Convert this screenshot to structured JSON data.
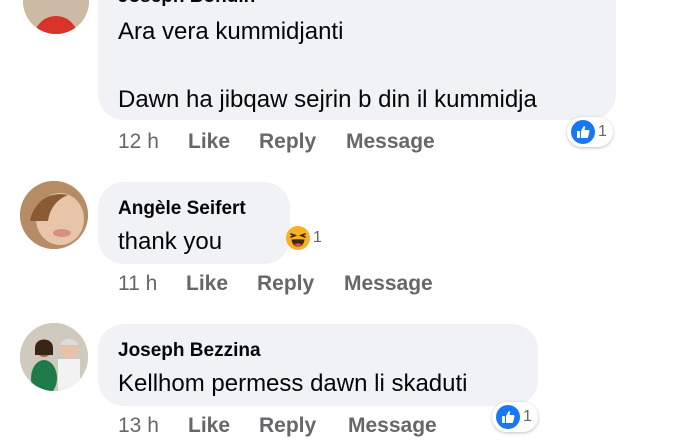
{
  "comments": [
    {
      "author": "Joseph Bondin",
      "lines": [
        "Ara vera kummidjanti",
        "Dawn ha jibqaw sejrin b din il kummidja"
      ],
      "time": "12 h",
      "reaction": {
        "icon": "like-icon",
        "count": "1",
        "color": "#1877f2"
      }
    },
    {
      "author": "Angèle Seifert",
      "lines": [
        "thank you"
      ],
      "time": "11 h",
      "reaction": {
        "icon": "haha-icon",
        "count": "1",
        "color": "#f7b125"
      }
    },
    {
      "author": "Joseph Bezzina",
      "lines": [
        "Kellhom permess dawn li skaduti"
      ],
      "time": "13 h",
      "reaction": {
        "icon": "like-icon",
        "count": "1",
        "color": "#1877f2"
      }
    }
  ],
  "actions": {
    "like": "Like",
    "reply": "Reply",
    "message": "Message"
  }
}
